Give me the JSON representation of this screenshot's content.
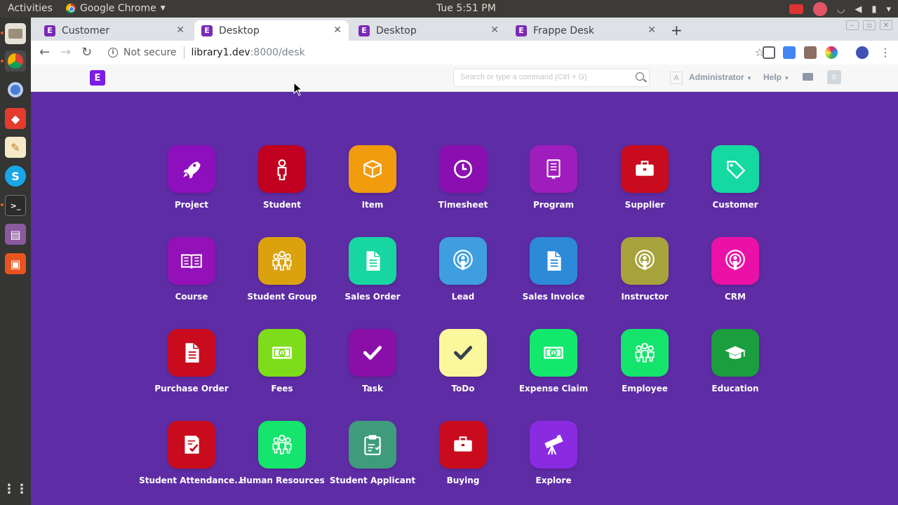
{
  "os": {
    "activities": "Activities",
    "app_name": "Google Chrome",
    "clock": "Tue   5:51 PM"
  },
  "browser": {
    "tabs": [
      {
        "title": "Customer",
        "active": false
      },
      {
        "title": "Desktop",
        "active": true
      },
      {
        "title": "Desktop",
        "active": false
      },
      {
        "title": "Frappe Desk",
        "active": false
      }
    ],
    "security": "Not secure",
    "url_host": "library1.dev",
    "url_path": ":8000/desk"
  },
  "navbar": {
    "logo": "E",
    "search_placeholder": "Search or type a command (Ctrl + G)",
    "avatar_letter": "A",
    "user": "Administrator",
    "help": "Help",
    "notifications": "0"
  },
  "desk": {
    "modules": [
      {
        "label": "Project",
        "color": "#8e0fbd",
        "icon": "rocket-icon"
      },
      {
        "label": "Student",
        "color": "#c2001f",
        "icon": "student-icon"
      },
      {
        "label": "Item",
        "color": "#f19c0c",
        "icon": "box-icon"
      },
      {
        "label": "Timesheet",
        "color": "#8b0fb0",
        "icon": "clock-icon"
      },
      {
        "label": "Program",
        "color": "#9f1cbd",
        "icon": "book-icon"
      },
      {
        "label": "Supplier",
        "color": "#c80c1e",
        "icon": "briefcase-icon"
      },
      {
        "label": "Customer",
        "color": "#14d9a0",
        "icon": "tag-icon"
      },
      {
        "label": "Course",
        "color": "#9410b8",
        "icon": "open-book-icon"
      },
      {
        "label": "Student Group",
        "color": "#dba20e",
        "icon": "group-icon"
      },
      {
        "label": "Sales Order",
        "color": "#18d6a0",
        "icon": "file-icon"
      },
      {
        "label": "Lead",
        "color": "#3e9ee0",
        "icon": "broadcast-icon"
      },
      {
        "label": "Sales Invoice",
        "color": "#2d8ad9",
        "icon": "file-icon"
      },
      {
        "label": "Instructor",
        "color": "#a8a23c",
        "icon": "broadcast-icon"
      },
      {
        "label": "CRM",
        "color": "#ec11a6",
        "icon": "broadcast-icon"
      },
      {
        "label": "Purchase Order",
        "color": "#c80c1e",
        "icon": "file-icon"
      },
      {
        "label": "Fees",
        "color": "#7ddd1a",
        "icon": "money-icon"
      },
      {
        "label": "Task",
        "color": "#8a0ea8",
        "icon": "check-icon"
      },
      {
        "label": "ToDo",
        "color": "#fbf79c",
        "icon": "check-dark-icon"
      },
      {
        "label": "Expense Claim",
        "color": "#12e86b",
        "icon": "money-icon"
      },
      {
        "label": "Employee",
        "color": "#14e46c",
        "icon": "group-icon"
      },
      {
        "label": "Education",
        "color": "#1b9e3d",
        "icon": "graduation-cap-icon"
      },
      {
        "label": "Student Attendance...",
        "color": "#c80c1e",
        "icon": "checklist-icon"
      },
      {
        "label": "Human Resources",
        "color": "#14e46c",
        "icon": "group-icon"
      },
      {
        "label": "Student Applicant",
        "color": "#3e9c7c",
        "icon": "clipboard-icon"
      },
      {
        "label": "Buying",
        "color": "#c80c1e",
        "icon": "briefcase-icon"
      },
      {
        "label": "Explore",
        "color": "#8a2be2",
        "icon": "telescope-icon"
      }
    ]
  }
}
